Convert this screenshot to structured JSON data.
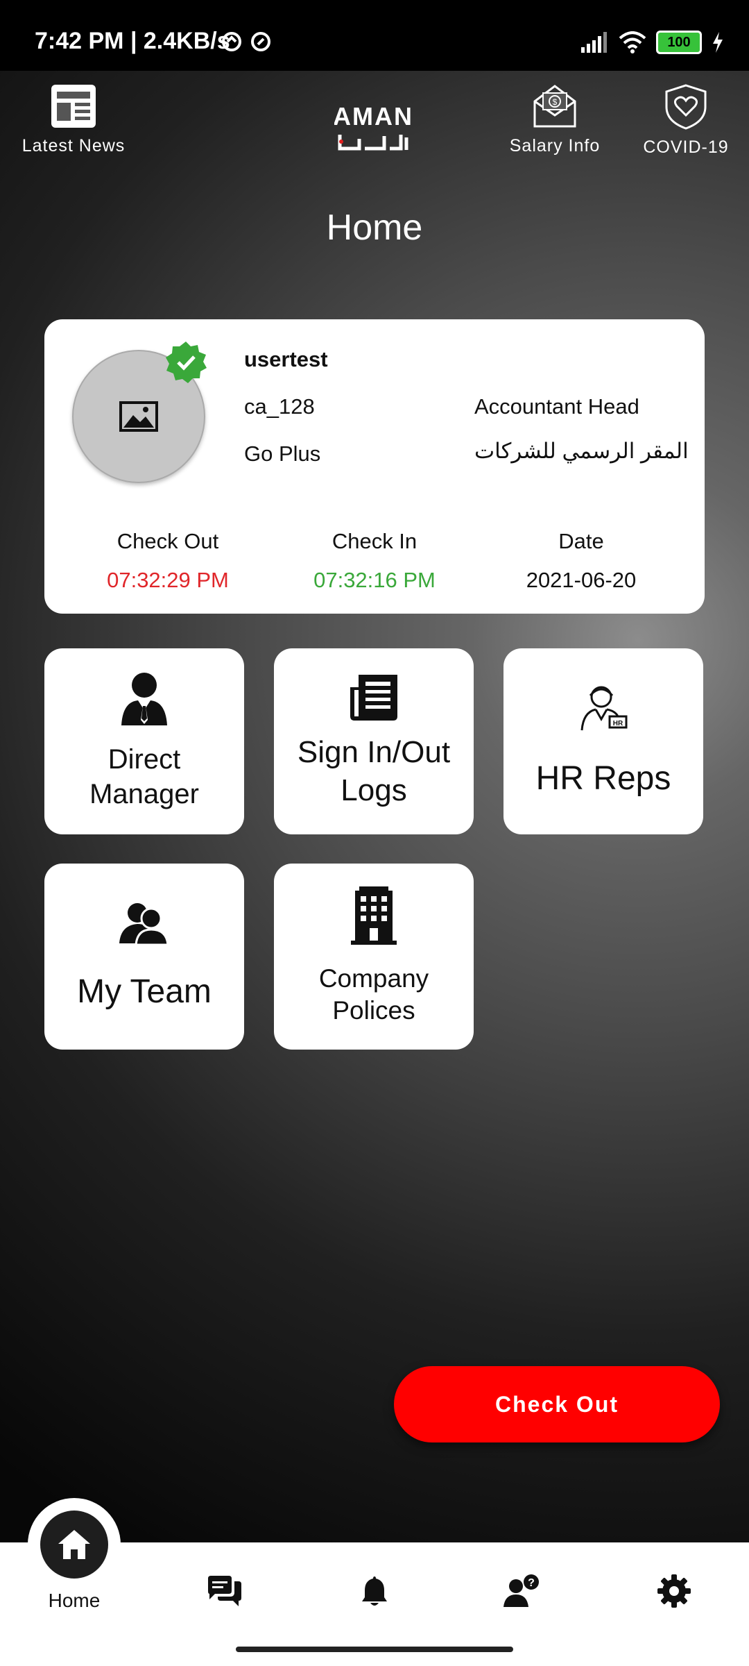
{
  "status_bar": {
    "time": "7:42 PM | 2.4KB/s",
    "battery": "100"
  },
  "top_nav": {
    "latest_news": "Latest News",
    "salary_info": "Salary Info",
    "covid": "COVID-19"
  },
  "page_title": "Home",
  "profile": {
    "username": "usertest",
    "code": "ca_128",
    "job_title": "Accountant Head",
    "company": "Go Plus",
    "branch": "المقر الرسمي للشركات",
    "check_out_label": "Check Out",
    "check_out_time": "07:32:29 PM",
    "check_in_label": "Check In",
    "check_in_time": "07:32:16 PM",
    "date_label": "Date",
    "date_value": "2021-06-20"
  },
  "tiles": {
    "direct_manager": "Direct\nManager",
    "sign_logs": "Sign In/Out\nLogs",
    "hr_reps": "HR Reps",
    "my_team": "My Team",
    "company_polices": "Company\nPolices"
  },
  "checkout_button": "Check Out",
  "bottom_nav": {
    "home": "Home"
  },
  "colors": {
    "checkout_red": "#ff0000",
    "check_out_time": "#e0262a",
    "check_in_time": "#3aa83a",
    "verified_green": "#3aa83a"
  }
}
